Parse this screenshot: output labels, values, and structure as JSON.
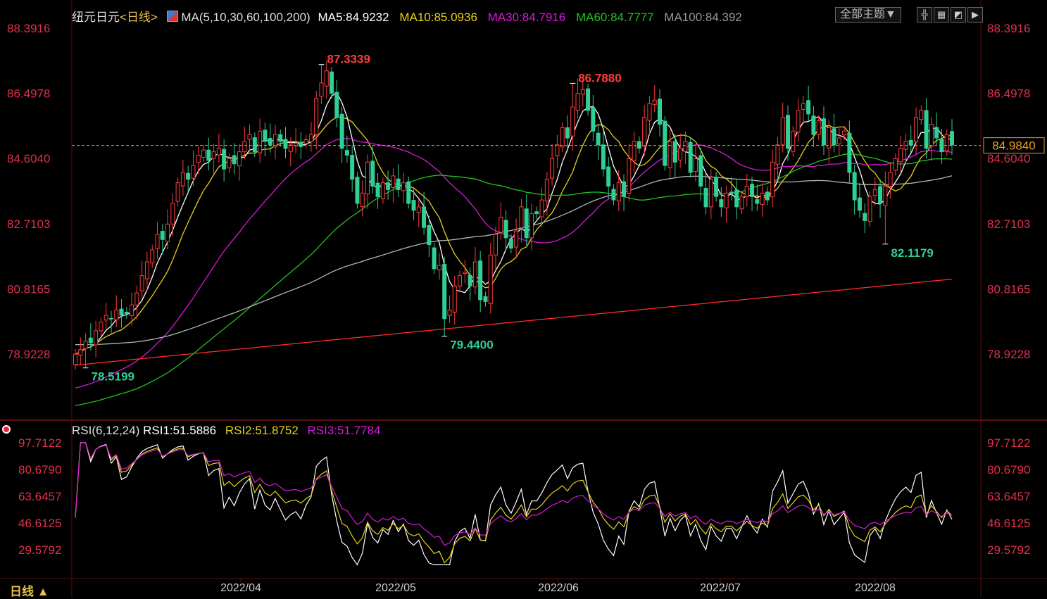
{
  "header": {
    "symbol": "纽元日元",
    "period_open": "<",
    "period": "日线",
    "period_close": ">",
    "ma_title": "MA(5,10,30,60,100,200)",
    "ma5": "MA5:84.9232",
    "ma10": "MA10:85.0936",
    "ma30": "MA30:84.7916",
    "ma60": "MA60:84.7777",
    "ma100": "MA100:84.392",
    "theme_button": "全部主题▼"
  },
  "rsi_header": {
    "title": "RSI(6,12,24)",
    "rsi1": "RSI1:51.5886",
    "rsi2": "RSI2:51.8752",
    "rsi3": "RSI3:51.7784"
  },
  "footer": {
    "period_label": "日线 ▲"
  },
  "colors": {
    "up": "#ff3d3d",
    "down": "#2fcf95",
    "ma5": "#ffffff",
    "ma10": "#e6d21a",
    "ma30": "#d91ad9",
    "ma60": "#21c221",
    "ma100": "#b5b5b5",
    "ma200": "#ff2a2a",
    "axis_text": "#e0304a",
    "grid": "#5a1010"
  },
  "chart_data": {
    "type": "candlestick",
    "price_ticks": [
      "88.3916",
      "86.4978",
      "84.6040",
      "82.7103",
      "80.8165",
      "78.9228"
    ],
    "rsi_ticks": [
      "97.7122",
      "80.6790",
      "63.6457",
      "46.6125",
      "29.5792"
    ],
    "x_ticks": [
      "2022/04",
      "2022/05",
      "2022/06",
      "2022/07",
      "2022/08"
    ],
    "current_price": "84.9840",
    "annotations": [
      {
        "label": "87.3339",
        "value": 87.3339,
        "kind": "high",
        "bar": 48
      },
      {
        "label": "86.7880",
        "value": 86.788,
        "kind": "high",
        "bar": 97
      },
      {
        "label": "79.4400",
        "value": 79.44,
        "kind": "low",
        "bar": 72
      },
      {
        "label": "82.1179",
        "value": 82.1179,
        "kind": "low",
        "bar": 158
      },
      {
        "label": "78.5199",
        "value": 78.5199,
        "kind": "low",
        "bar": 2
      }
    ],
    "closes": [
      78.92,
      79.05,
      79.3,
      79.25,
      79.6,
      79.85,
      80.05,
      79.95,
      80.2,
      80.05,
      80.1,
      80.35,
      80.7,
      81.2,
      81.6,
      81.95,
      82.4,
      82.25,
      82.7,
      83.3,
      83.9,
      84.2,
      84.0,
      84.4,
      84.7,
      84.85,
      84.55,
      84.8,
      84.9,
      84.3,
      84.6,
      84.45,
      84.8,
      85.1,
      85.3,
      84.8,
      85.4,
      85.1,
      85.0,
      85.3,
      85.1,
      84.9,
      85.0,
      85.05,
      84.95,
      85.15,
      85.3,
      86.35,
      86.8,
      87.15,
      86.5,
      85.8,
      84.9,
      84.7,
      84.0,
      83.3,
      83.6,
      84.5,
      83.8,
      83.5,
      83.9,
      83.7,
      84.1,
      83.7,
      83.9,
      83.3,
      83.1,
      83.2,
      82.6,
      82.1,
      81.4,
      81.5,
      79.95,
      80.2,
      80.9,
      81.2,
      81.3,
      80.9,
      81.6,
      80.5,
      80.45,
      81.8,
      82.4,
      82.9,
      82.3,
      82.0,
      82.5,
      83.2,
      82.3,
      83.0,
      83.0,
      83.4,
      84.0,
      84.6,
      85.0,
      85.5,
      85.2,
      86.1,
      86.5,
      86.6,
      86.0,
      85.4,
      85.0,
      84.3,
      83.8,
      83.4,
      83.9,
      83.5,
      84.6,
      85.1,
      84.9,
      85.8,
      86.2,
      86.3,
      85.6,
      84.4,
      85.1,
      84.5,
      84.9,
      85.1,
      84.2,
      84.6,
      83.8,
      83.2,
      84.0,
      83.5,
      83.2,
      83.6,
      83.6,
      83.2,
      83.5,
      83.8,
      83.5,
      83.3,
      83.6,
      83.4,
      84.5,
      85.0,
      85.8,
      84.9,
      85.4,
      86.0,
      86.2,
      85.9,
      85.3,
      85.7,
      85.0,
      85.5,
      85.0,
      85.2,
      85.4,
      84.2,
      83.4,
      83.1,
      82.8,
      83.5,
      83.7,
      83.3,
      83.8,
      84.2,
      84.6,
      84.9,
      85.1,
      85.0,
      85.8,
      86.0,
      84.9,
      85.6,
      85.2,
      84.8,
      85.3,
      85.0
    ],
    "ma_series": [
      {
        "name": "MA5",
        "period": 5
      },
      {
        "name": "MA10",
        "period": 10
      },
      {
        "name": "MA30",
        "period": 30
      },
      {
        "name": "MA60",
        "period": 60
      },
      {
        "name": "MA100",
        "period": 100
      },
      {
        "name": "MA200",
        "period": 200
      }
    ],
    "rsi_series": [
      {
        "name": "RSI1",
        "period": 6
      },
      {
        "name": "RSI2",
        "period": 12
      },
      {
        "name": "RSI3",
        "period": 24
      }
    ]
  }
}
